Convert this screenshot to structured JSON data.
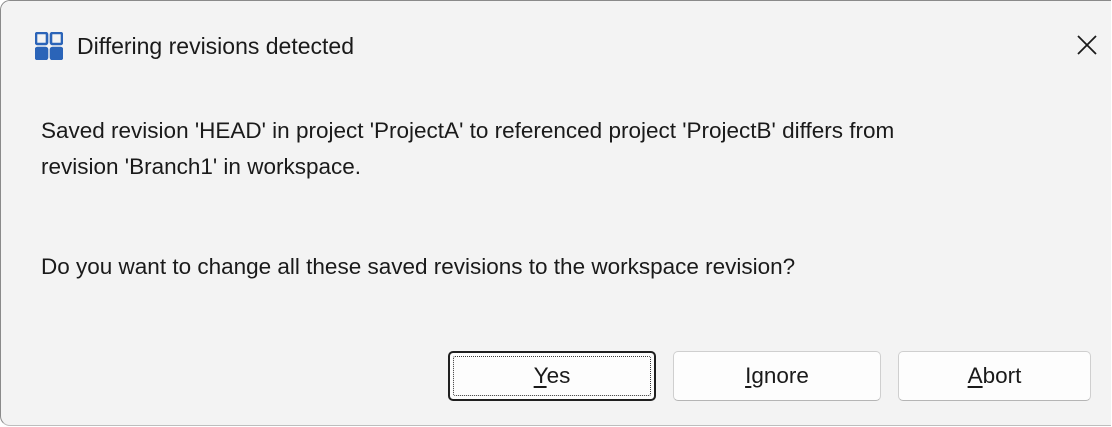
{
  "dialog": {
    "title": "Differing revisions detected",
    "title_icon": "app-grid-icon",
    "close_icon": "close-icon",
    "message_line1": "Saved revision 'HEAD' in project 'ProjectA' to referenced project 'ProjectB'  differs from",
    "message_line2": "revision 'Branch1' in workspace.",
    "question": "Do you want to change all these saved revisions to the workspace revision?"
  },
  "buttons": {
    "yes": {
      "mnemonic": "Y",
      "rest": "es",
      "focused": true
    },
    "ignore": {
      "mnemonic": "I",
      "rest": "gnore"
    },
    "abort": {
      "mnemonic": "A",
      "rest": "bort"
    }
  },
  "colors": {
    "accent": "#2b64b8",
    "dialog_bg": "#f3f3f3",
    "button_bg": "#fdfdfd",
    "text": "#1a1a1a"
  }
}
